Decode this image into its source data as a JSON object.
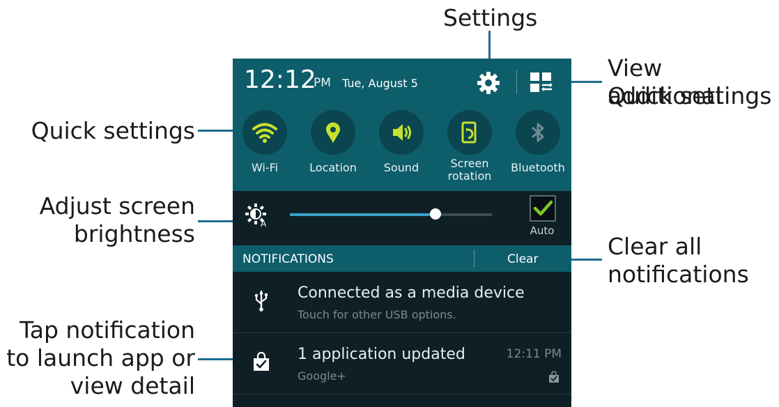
{
  "callouts": {
    "settings": "Settings",
    "view_additional_1": "View additional",
    "view_additional_2": "Quick settings",
    "quick_settings": "Quick settings",
    "adjust_1": "Adjust screen",
    "adjust_2": "brightness",
    "clear_1": "Clear all",
    "clear_2": "notifications",
    "tap_1": "Tap notification",
    "tap_2": "to launch app or",
    "tap_3": "view detail"
  },
  "status_bar": {
    "time": "12:12",
    "ampm": "PM",
    "date": "Tue, August 5",
    "settings_icon": "gear-icon",
    "quick_settings_grid_icon": "grid-edit-icon"
  },
  "quick_settings": [
    {
      "label": "Wi-Fi",
      "label2": "",
      "icon": "wifi-icon",
      "active": true
    },
    {
      "label": "Location",
      "label2": "",
      "icon": "location-pin-icon",
      "active": true
    },
    {
      "label": "Sound",
      "label2": "",
      "icon": "sound-icon",
      "active": true
    },
    {
      "label": "Screen",
      "label2": "rotation",
      "icon": "screen-rotation-icon",
      "active": true
    },
    {
      "label": "Bluetooth",
      "label2": "",
      "icon": "bluetooth-icon",
      "active": false
    }
  ],
  "brightness": {
    "level_fraction": 0.72,
    "auto_label": "Auto",
    "auto_checked": true
  },
  "notifications": {
    "header": "NOTIFICATIONS",
    "clear_label": "Clear",
    "items": [
      {
        "title": "Connected as a media device",
        "subtitle": "Touch for other USB options.",
        "time": "",
        "icon": "usb-icon"
      },
      {
        "title": "1 application updated",
        "subtitle": "Google+",
        "time": "12:11 PM",
        "icon": "shopping-bag-check-icon"
      }
    ]
  },
  "colors": {
    "accent_active": "#c7e12e",
    "accent_inactive": "#6f8c92",
    "panel_teal": "#0e5d6a",
    "panel_dark": "#0f1f26",
    "leader_blue": "#1f6a93"
  }
}
